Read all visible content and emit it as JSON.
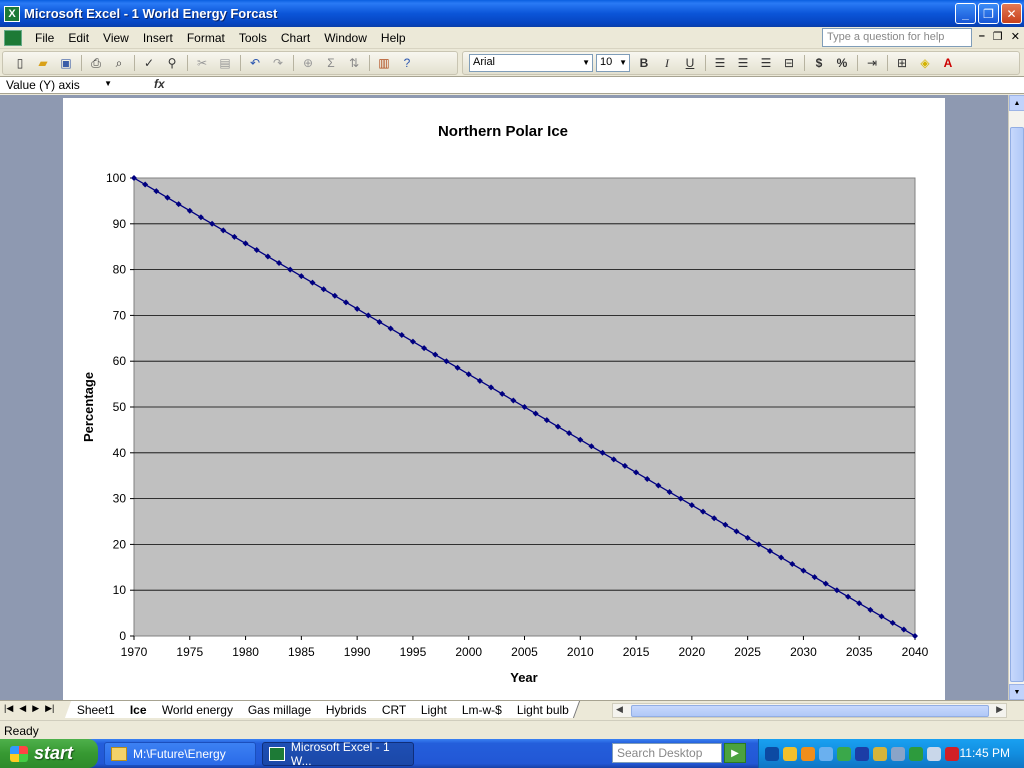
{
  "window": {
    "app_icon": "excel-icon",
    "title": "Microsoft Excel - 1 World Energy Forcast",
    "buttons": {
      "minimize": "_",
      "maximize": "❐",
      "close": "✕"
    }
  },
  "menu": {
    "items": [
      "File",
      "Edit",
      "View",
      "Insert",
      "Format",
      "Tools",
      "Chart",
      "Window",
      "Help"
    ],
    "help_placeholder": "Type a question for help"
  },
  "format_toolbar": {
    "font": "Arial",
    "size": "10",
    "bold": "B",
    "italic": "I",
    "underline": "U",
    "currency": "$",
    "percent": "%"
  },
  "namebox": {
    "value": "Value (Y) axis",
    "fx": "fx"
  },
  "chart_data": {
    "type": "line",
    "title": "Northern Polar Ice",
    "xlabel": "Year",
    "ylabel": "Percentage",
    "xlim": [
      1970,
      2040
    ],
    "ylim": [
      0,
      100
    ],
    "x_ticks": [
      "1970",
      "1975",
      "1980",
      "1985",
      "1990",
      "1995",
      "2000",
      "2005",
      "2010",
      "2015",
      "2020",
      "2025",
      "2030",
      "2035",
      "2040"
    ],
    "y_ticks": [
      "0",
      "10",
      "20",
      "30",
      "40",
      "50",
      "60",
      "70",
      "80",
      "90",
      "100"
    ],
    "gridlines": "horizontal",
    "plot_background": "#c0c0c0",
    "series": [
      {
        "color": "#000080",
        "marker": "diamond",
        "x_start": 1970,
        "x_end": 2040,
        "step": 1,
        "y_start": 100,
        "y_end": 0
      }
    ]
  },
  "sheets": {
    "tabs": [
      "Sheet1",
      "Ice",
      "World energy",
      "Gas millage",
      "Hybrids",
      "CRT",
      "Light",
      "Lm-w-$",
      "Light bulb"
    ],
    "active": "Ice"
  },
  "status": {
    "text": "Ready"
  },
  "taskbar": {
    "start": "start",
    "tasks": [
      "M:\\Future\\Energy",
      "Microsoft Excel - 1 W..."
    ],
    "search_placeholder": "Search Desktop",
    "clock": "11:45 PM"
  }
}
